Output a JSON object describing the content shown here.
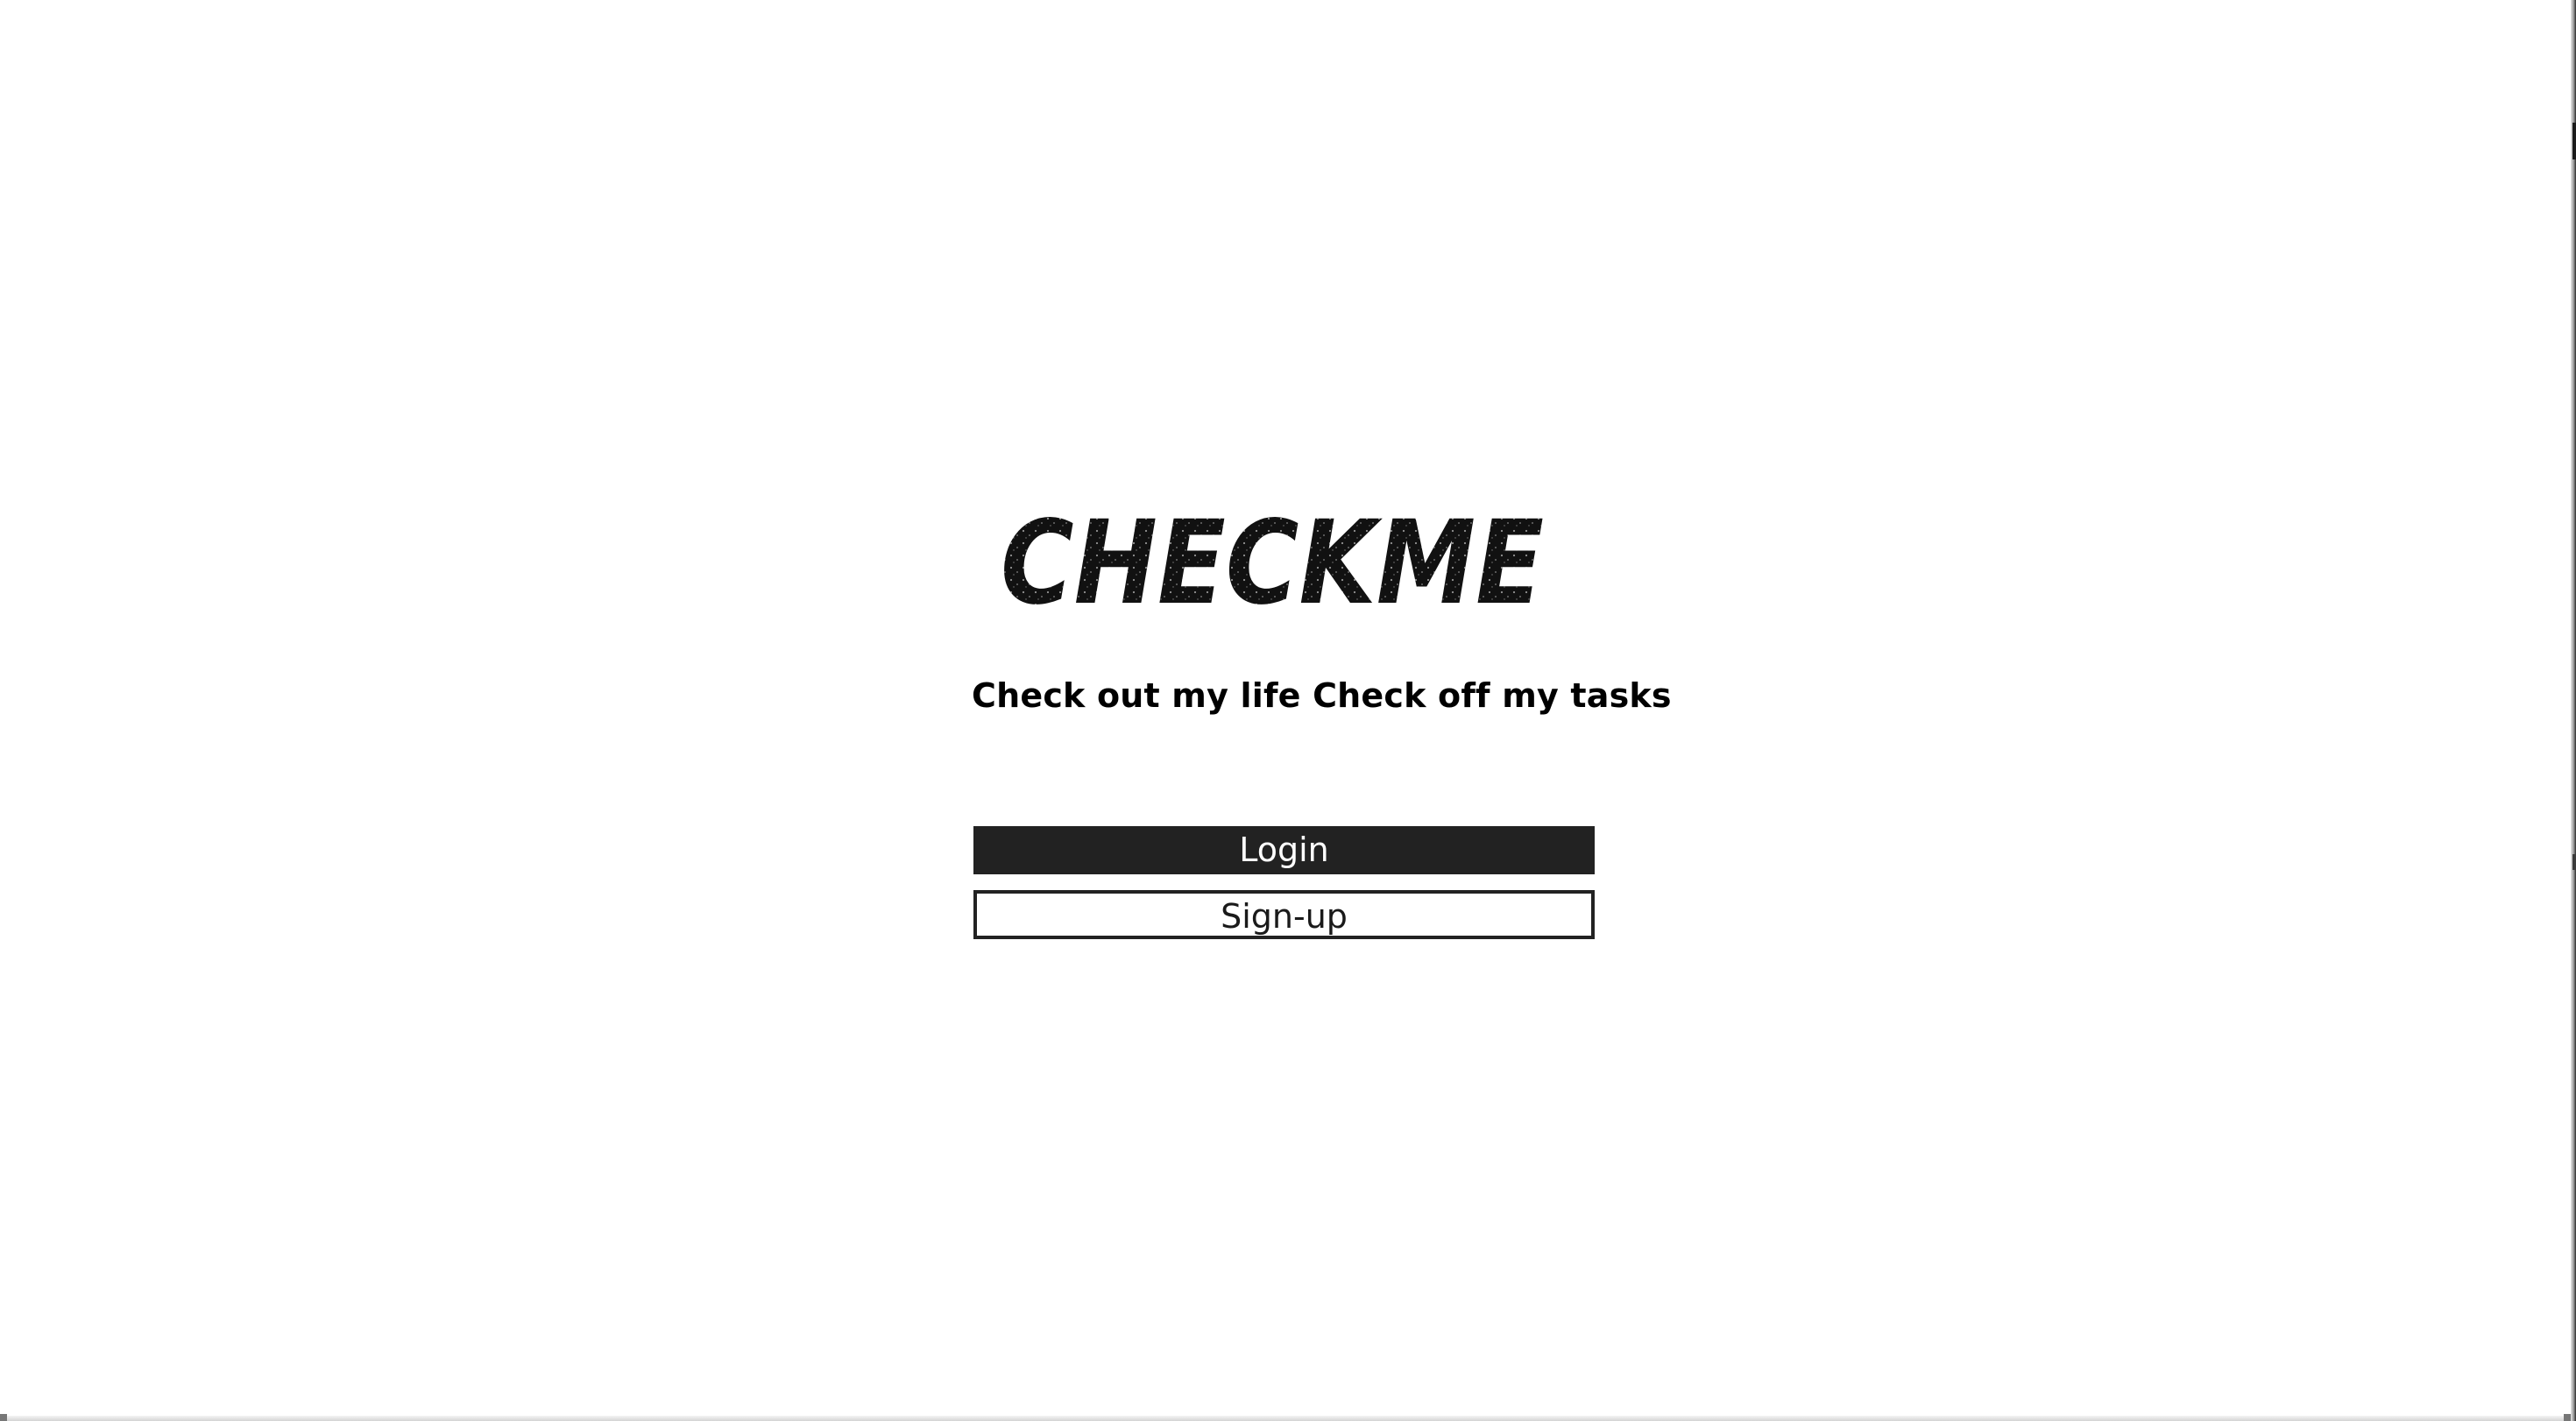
{
  "app": {
    "logo_text": "CHECKME",
    "tagline": "Check out my life Check off my tasks"
  },
  "actions": {
    "login_label": "Login",
    "signup_label": "Sign-up"
  },
  "colors": {
    "background": "#ffffff",
    "primary_button": "#222222",
    "primary_button_text": "#ffffff",
    "secondary_button_border": "#222222",
    "text": "#000000"
  }
}
